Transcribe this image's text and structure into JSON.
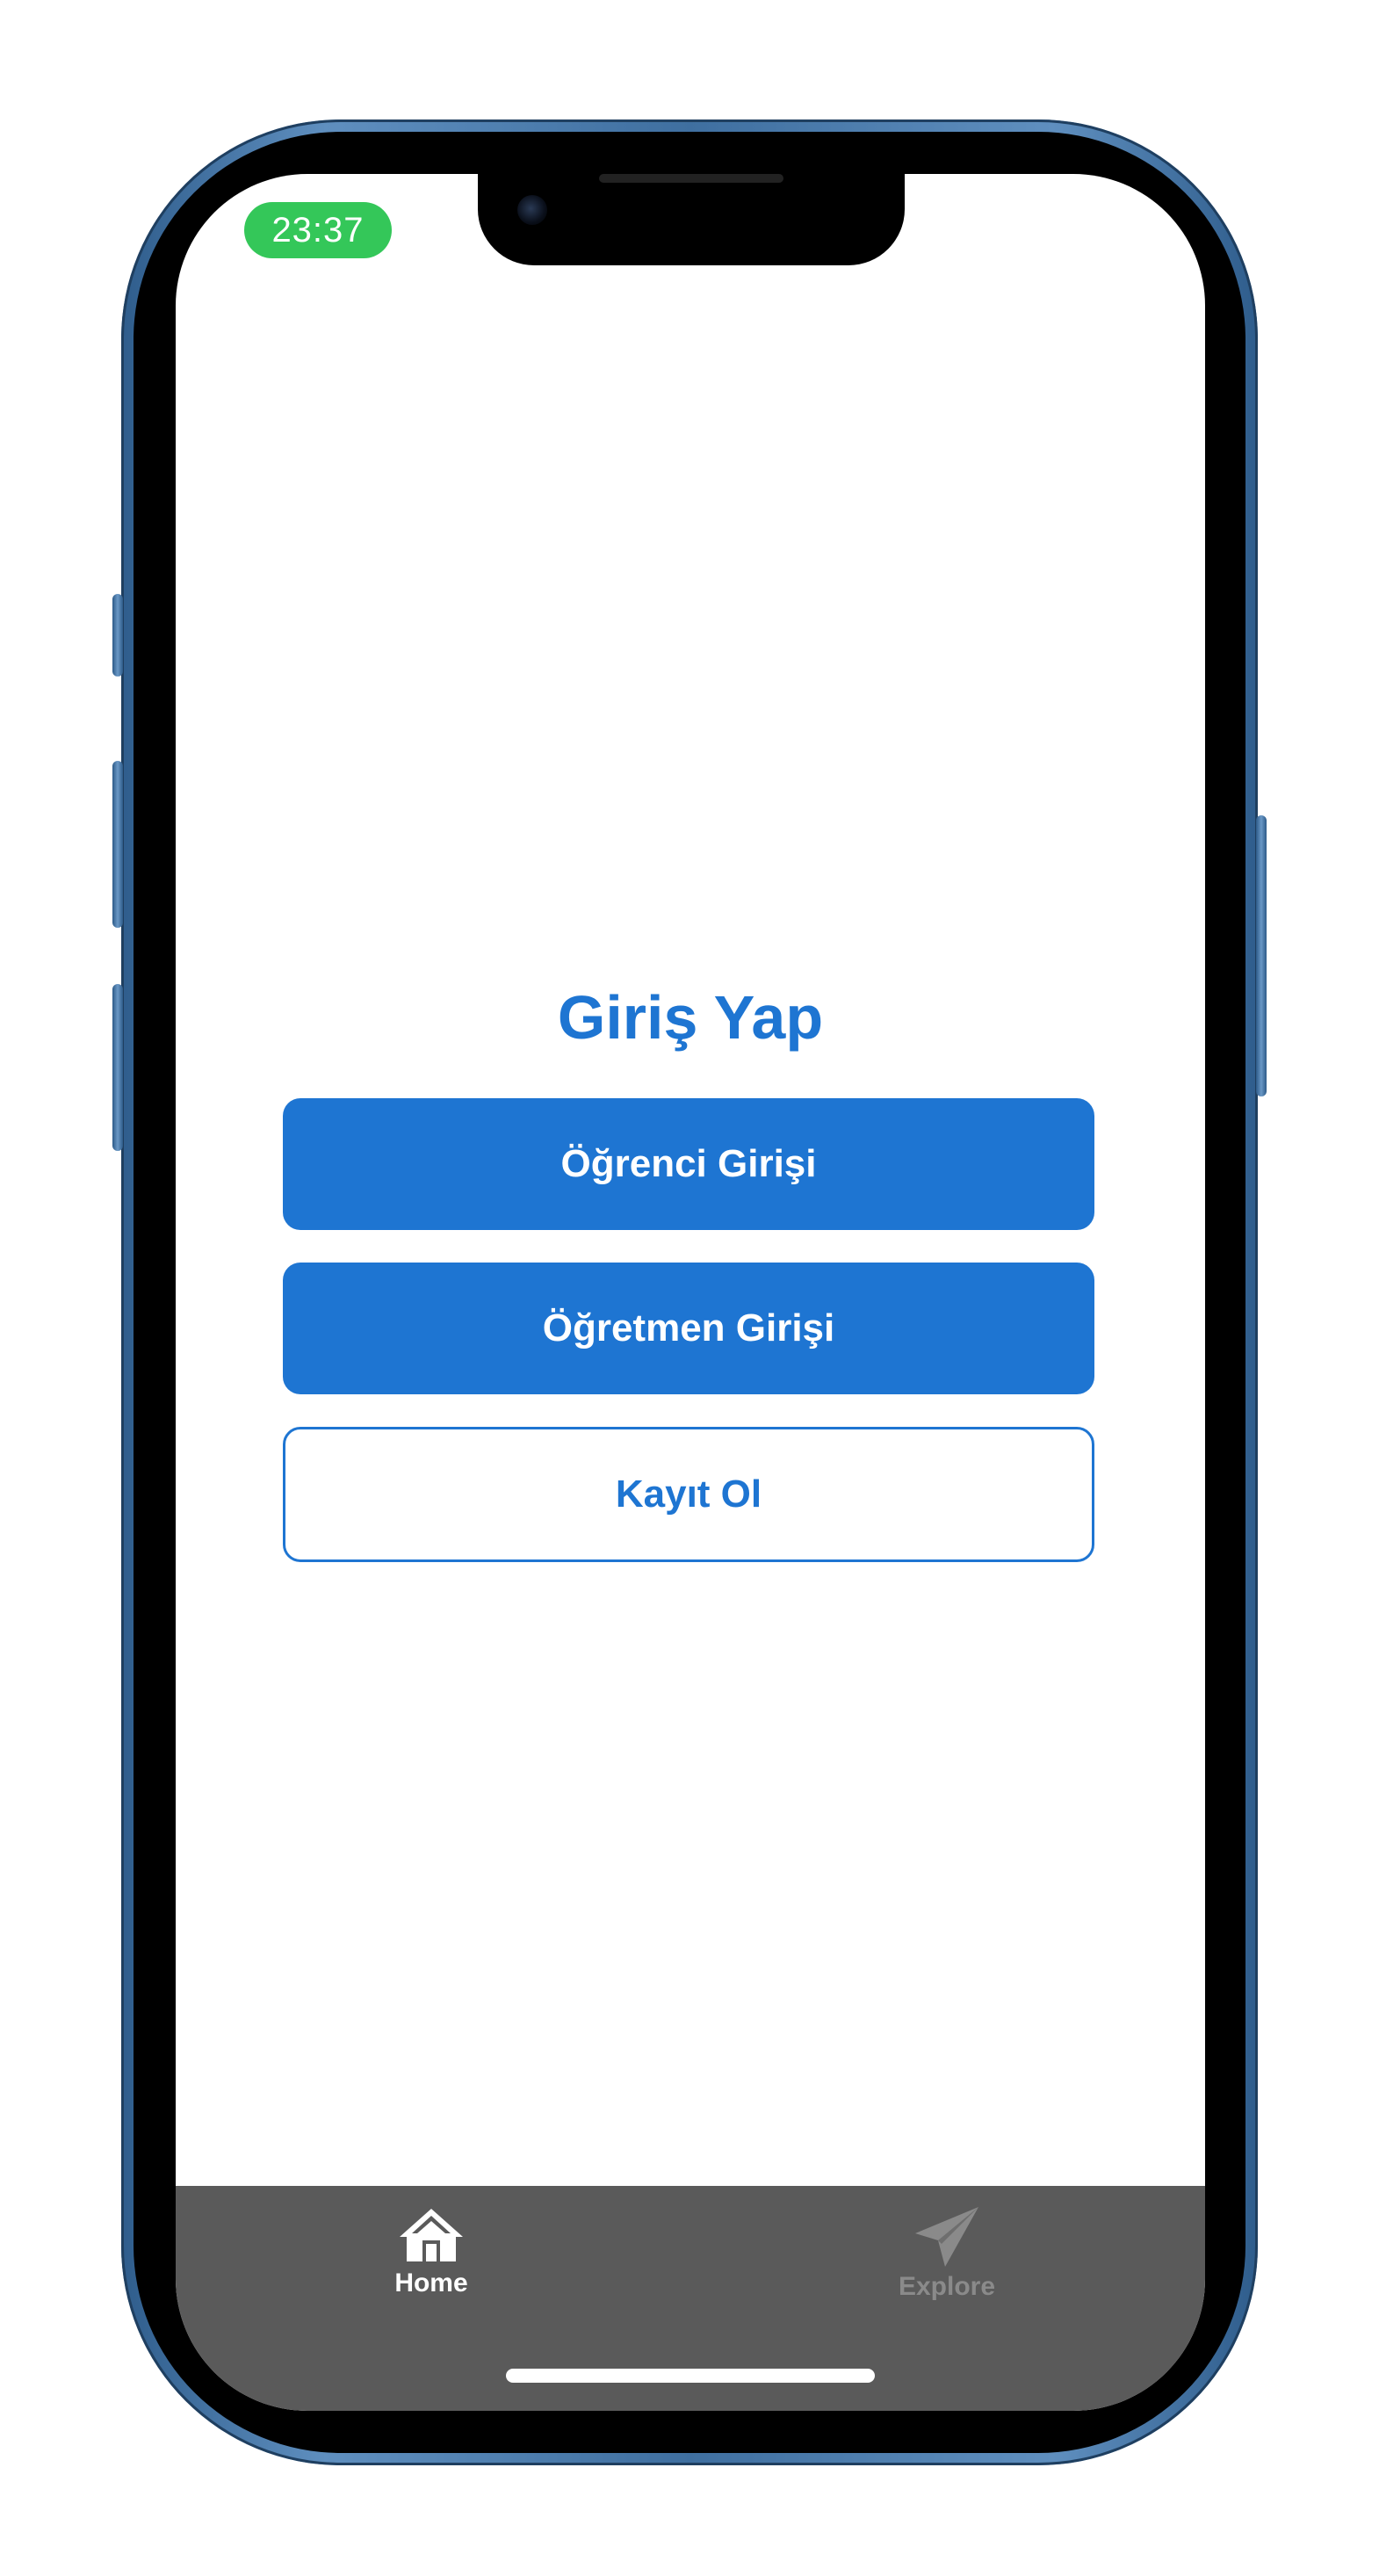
{
  "status_bar": {
    "time": "23:37",
    "time_pill_color": "#34c759"
  },
  "main": {
    "title": "Giriş Yap",
    "student_login_label": "Öğrenci Girişi",
    "teacher_login_label": "Öğretmen Girişi",
    "register_label": "Kayıt Ol"
  },
  "tabbar": {
    "tabs": [
      {
        "label": "Home",
        "icon": "home-icon",
        "active": true
      },
      {
        "label": "Explore",
        "icon": "paper-plane-icon",
        "active": false
      }
    ]
  },
  "colors": {
    "accent": "#1e75d2",
    "tabbar_background": "#5a5a5a",
    "inactive_tab": "#8a8a8a"
  }
}
